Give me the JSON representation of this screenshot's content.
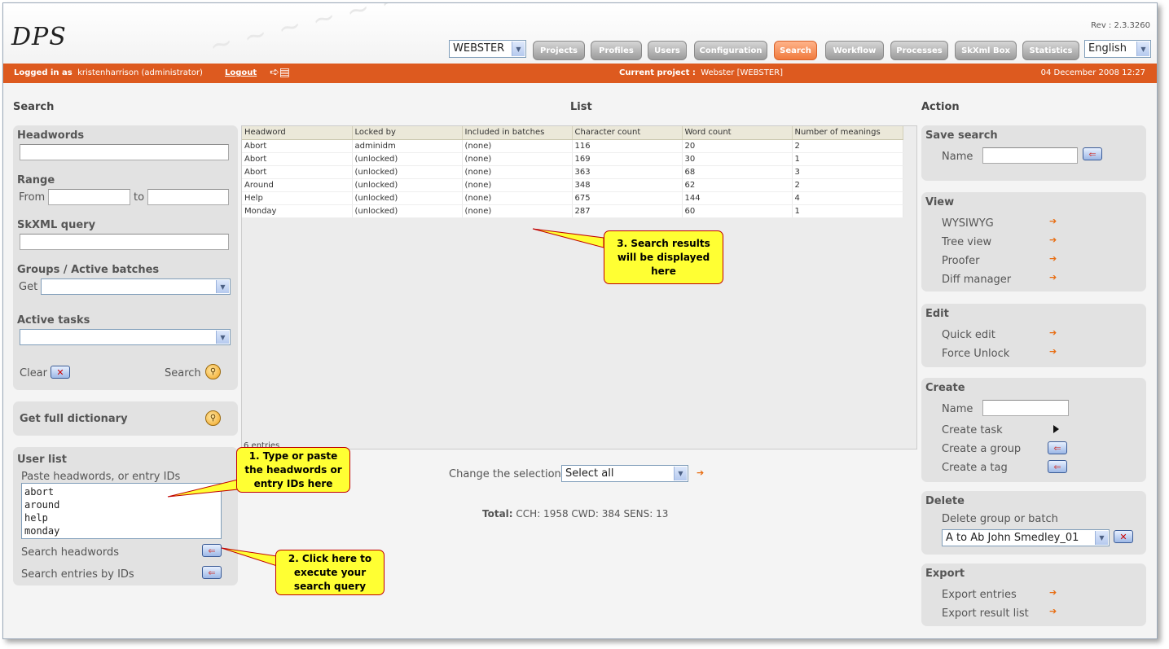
{
  "app": {
    "logo": "DPS",
    "revision": "Rev : 2.3.3260",
    "project_select": "WEBSTER",
    "language_select": "English",
    "nav": [
      "Projects",
      "Profiles",
      "Users",
      "Configuration",
      "Search",
      "Workflow",
      "Processes",
      "SkXml Box",
      "Statistics"
    ],
    "active_nav": "Search"
  },
  "userbar": {
    "logged_in_label": "Logged in as",
    "user": "kristenharrison (administrator)",
    "logout": "Logout",
    "current_project_label": "Current project :",
    "current_project": "Webster [WEBSTER]",
    "datetime": "04 December 2008 12:27"
  },
  "columns": {
    "search": "Search",
    "list": "List",
    "action": "Action"
  },
  "search": {
    "headwords_title": "Headwords",
    "range_title": "Range",
    "from_label": "From",
    "to_label": "to",
    "skxml_title": "SkXML query",
    "groups_title": "Groups / Active batches",
    "get_label": "Get",
    "tasks_title": "Active tasks",
    "clear_label": "Clear",
    "search_label": "Search",
    "full_dictionary": "Get full dictionary"
  },
  "userlist": {
    "title": "User list",
    "hint": "Paste headwords, or entry IDs",
    "content": "abort\naround\nhelp\nmonday",
    "search_headwords": "Search headwords",
    "search_ids": "Search entries by IDs"
  },
  "table": {
    "headers": [
      "Headword",
      "Locked by",
      "Included in batches",
      "Character count",
      "Word count",
      "Number of meanings"
    ],
    "rows": [
      [
        "Abort",
        "adminidm",
        "(none)",
        "116",
        "20",
        "2"
      ],
      [
        "Abort",
        "(unlocked)",
        "(none)",
        "169",
        "30",
        "1"
      ],
      [
        "Abort",
        "(unlocked)",
        "(none)",
        "363",
        "68",
        "3"
      ],
      [
        "Around",
        "(unlocked)",
        "(none)",
        "348",
        "62",
        "2"
      ],
      [
        "Help",
        "(unlocked)",
        "(none)",
        "675",
        "144",
        "4"
      ],
      [
        "Monday",
        "(unlocked)",
        "(none)",
        "287",
        "60",
        "1"
      ]
    ],
    "entries": "6 entries"
  },
  "selection": {
    "label": "Change the selection",
    "value": "Select all"
  },
  "total": {
    "label": "Total:",
    "value": "CCH: 1958 CWD: 384 SENS: 13"
  },
  "callouts": {
    "one": "1. Type or paste the headwords or entry IDs here",
    "two": "2. Click here to execute your search query",
    "three": "3. Search results will be displayed here"
  },
  "actions": {
    "save_title": "Save search",
    "save_name_label": "Name",
    "view_title": "View",
    "view_items": [
      "WYSIWYG",
      "Tree view",
      "Proofer",
      "Diff manager"
    ],
    "edit_title": "Edit",
    "edit_items": [
      "Quick edit",
      "Force Unlock"
    ],
    "create_title": "Create",
    "create_name_label": "Name",
    "create_task": "Create task",
    "create_group": "Create a group",
    "create_tag": "Create a tag",
    "delete_title": "Delete",
    "delete_label": "Delete group or batch",
    "delete_select": "A to Ab John Smedley_01",
    "export_title": "Export",
    "export_entries": "Export entries",
    "export_result": "Export result list"
  }
}
